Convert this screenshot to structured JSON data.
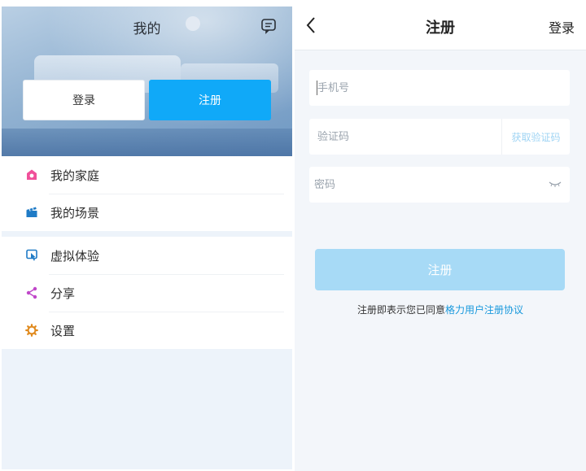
{
  "mine": {
    "title": "我的",
    "login_button": "登录",
    "register_button": "注册",
    "menu_group_1": [
      {
        "label": "我的家庭",
        "icon": "home-icon",
        "color": "#f0509a"
      },
      {
        "label": "我的场景",
        "icon": "scene-clapper-icon",
        "color": "#1f7bc6"
      }
    ],
    "menu_group_2": [
      {
        "label": "虚拟体验",
        "icon": "virtual-experience-icon",
        "color": "#1f7bc6"
      },
      {
        "label": "分享",
        "icon": "share-icon",
        "color": "#c047c9"
      },
      {
        "label": "设置",
        "icon": "settings-gear-icon",
        "color": "#e08a1e"
      }
    ]
  },
  "register": {
    "title": "注册",
    "top_login": "登录",
    "phone_placeholder": "手机号",
    "code_placeholder": "验证码",
    "get_code_button": "获取验证码",
    "password_placeholder": "密码",
    "submit_button": "注册",
    "agreement_prefix": "注册即表示您已同意",
    "agreement_link": "格力用户注册协议"
  },
  "colors": {
    "accent": "#10a9f8",
    "accent_disabled": "#a7daf6",
    "link": "#1798dc"
  }
}
